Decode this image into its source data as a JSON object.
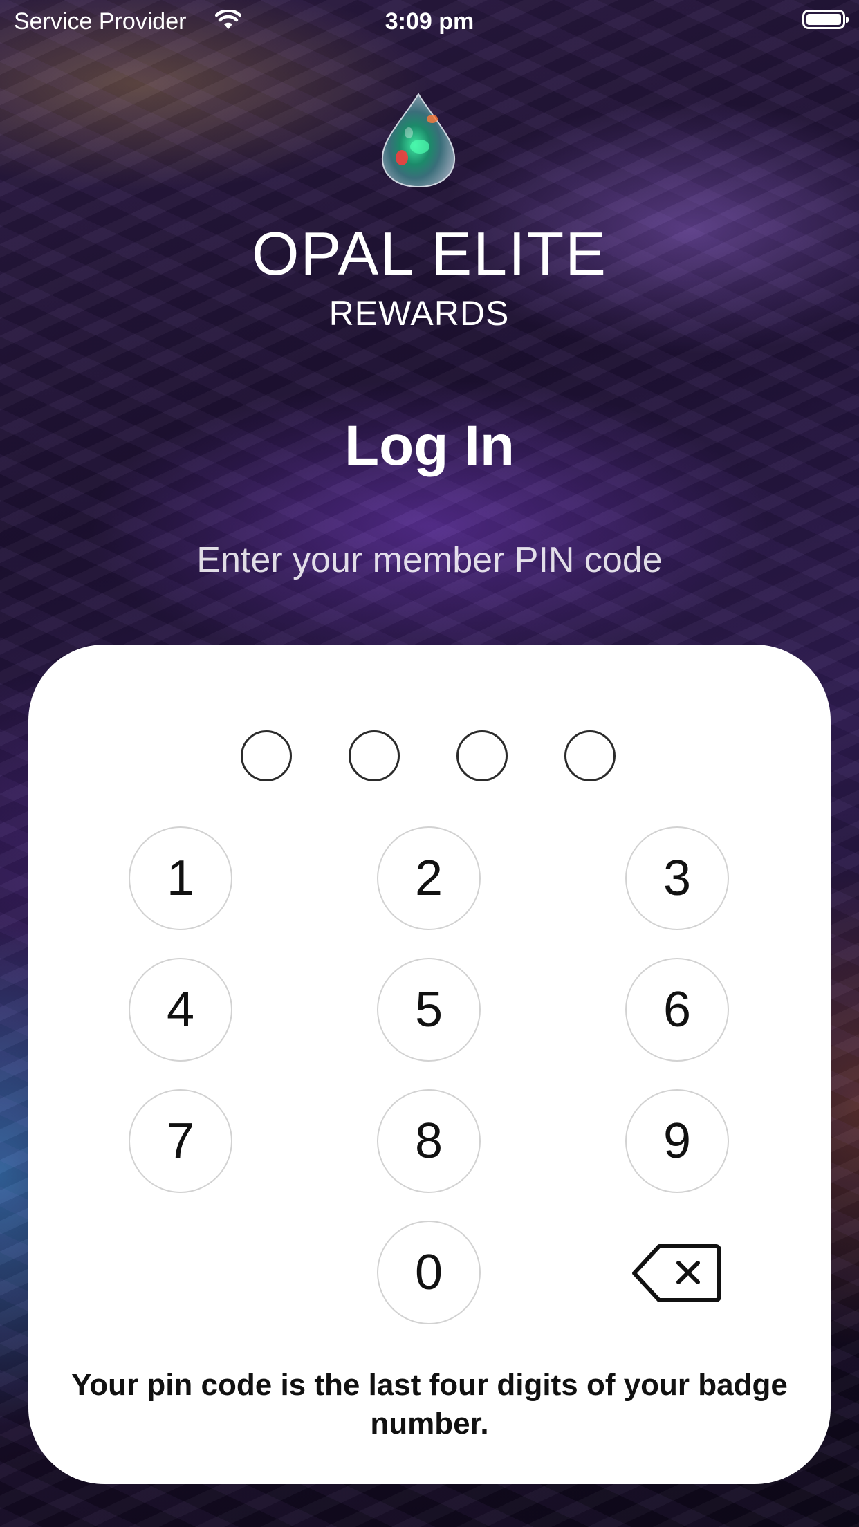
{
  "status_bar": {
    "carrier": "Service Provider",
    "time": "3:09 pm",
    "wifi_icon": "wifi-icon",
    "battery_icon": "battery-full-icon"
  },
  "brand": {
    "logo_icon": "opal-gem-icon",
    "name": "OPAL ELITE",
    "sub": "REWARDS"
  },
  "login": {
    "title": "Log In",
    "subtitle": "Enter your member PIN code"
  },
  "pin": {
    "length": 4,
    "entered": 0
  },
  "keypad": {
    "keys": [
      "1",
      "2",
      "3",
      "4",
      "5",
      "6",
      "7",
      "8",
      "9",
      "0"
    ],
    "delete_icon": "backspace-icon"
  },
  "hint": "Your pin code is the last four digits of your badge number.",
  "colors": {
    "card": "#ffffff",
    "key_border": "#d2d2d2",
    "text_dark": "#111111"
  }
}
